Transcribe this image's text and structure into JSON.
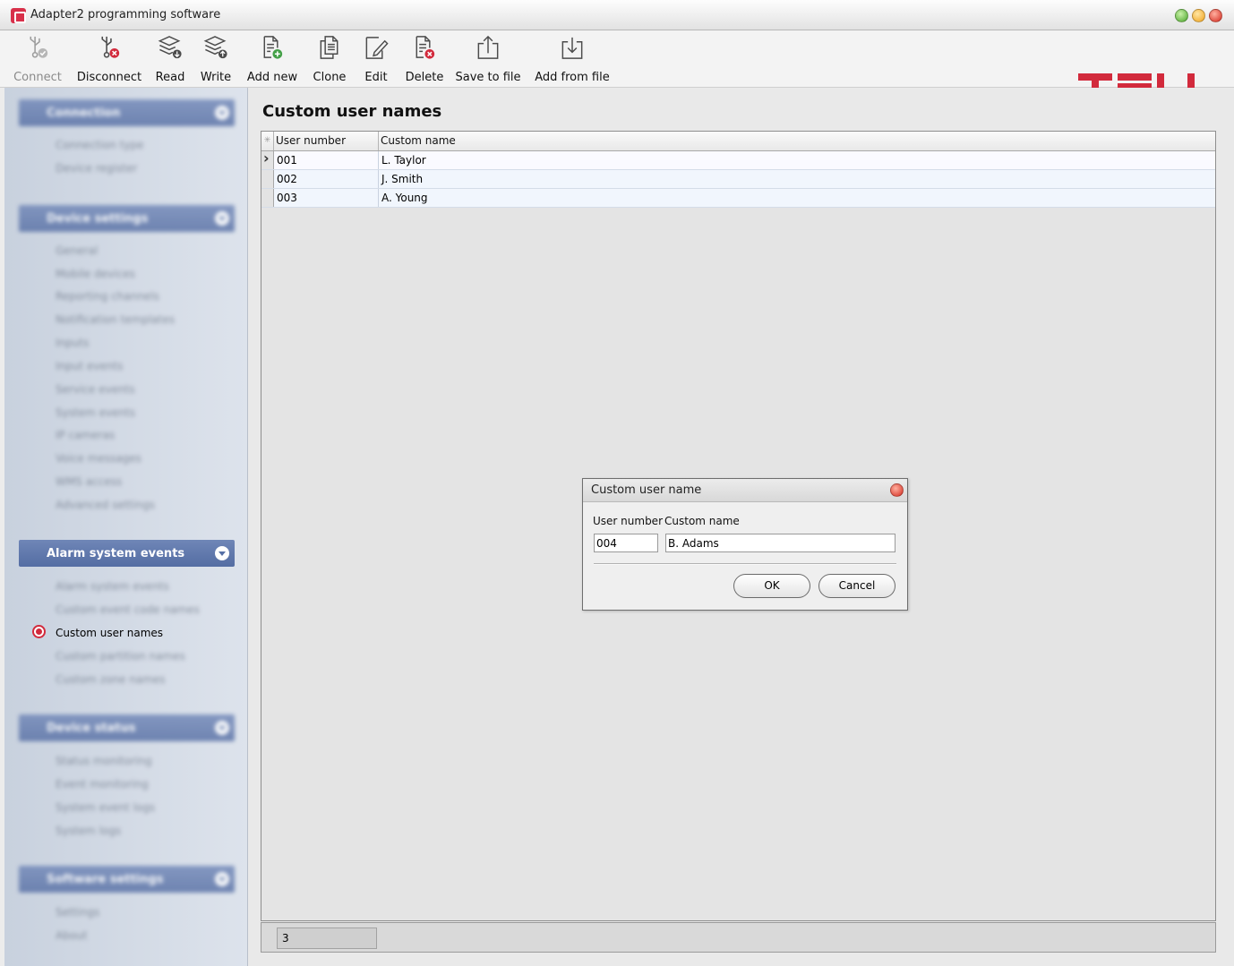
{
  "window": {
    "title": "Adapter2 programming software",
    "controls": [
      "minimize",
      "maximize",
      "close"
    ]
  },
  "toolbar": {
    "connect": "Connect",
    "disconnect": "Disconnect",
    "read": "Read",
    "write": "Write",
    "add_new": "Add new",
    "clone": "Clone",
    "edit": "Edit",
    "delete": "Delete",
    "save_to_file": "Save to file",
    "add_from_file": "Add from file",
    "brand": "TELL"
  },
  "sidebar": {
    "sections": [
      {
        "label": "Connection",
        "items": [
          "Connection type",
          "Device register"
        ]
      },
      {
        "label": "Device settings",
        "items": [
          "General",
          "Mobile devices",
          "Reporting channels",
          "Notification templates",
          "Inputs",
          "Input events",
          "Service events",
          "System events",
          "IP cameras",
          "Voice messages",
          "WMS access",
          "Advanced settings"
        ]
      },
      {
        "label": "Alarm system events",
        "items": [
          "Alarm system events",
          "Custom event code names",
          "Custom user names",
          "Custom partition names",
          "Custom zone names"
        ],
        "active_item": "Custom user names"
      },
      {
        "label": "Device status",
        "items": [
          "Status monitoring",
          "Event monitoring",
          "System event logs",
          "System logs"
        ]
      },
      {
        "label": "Software settings",
        "items": [
          "Settings",
          "About"
        ]
      }
    ]
  },
  "main": {
    "title": "Custom user names",
    "columns": [
      "User number",
      "Custom name"
    ],
    "rows": [
      {
        "user_number": "001",
        "custom_name": "L. Taylor"
      },
      {
        "user_number": "002",
        "custom_name": "J. Smith"
      },
      {
        "user_number": "003",
        "custom_name": "A. Young"
      }
    ],
    "record_count": "3"
  },
  "dialog": {
    "title": "Custom user name",
    "user_number_label": "User number",
    "custom_name_label": "Custom name",
    "user_number_value": "004",
    "custom_name_value": "B. Adams",
    "ok": "OK",
    "cancel": "Cancel"
  },
  "colors": {
    "brand": "#d22a3c",
    "sidebar_header": "#5f79ad",
    "row_alt": "#f1f6fd"
  }
}
